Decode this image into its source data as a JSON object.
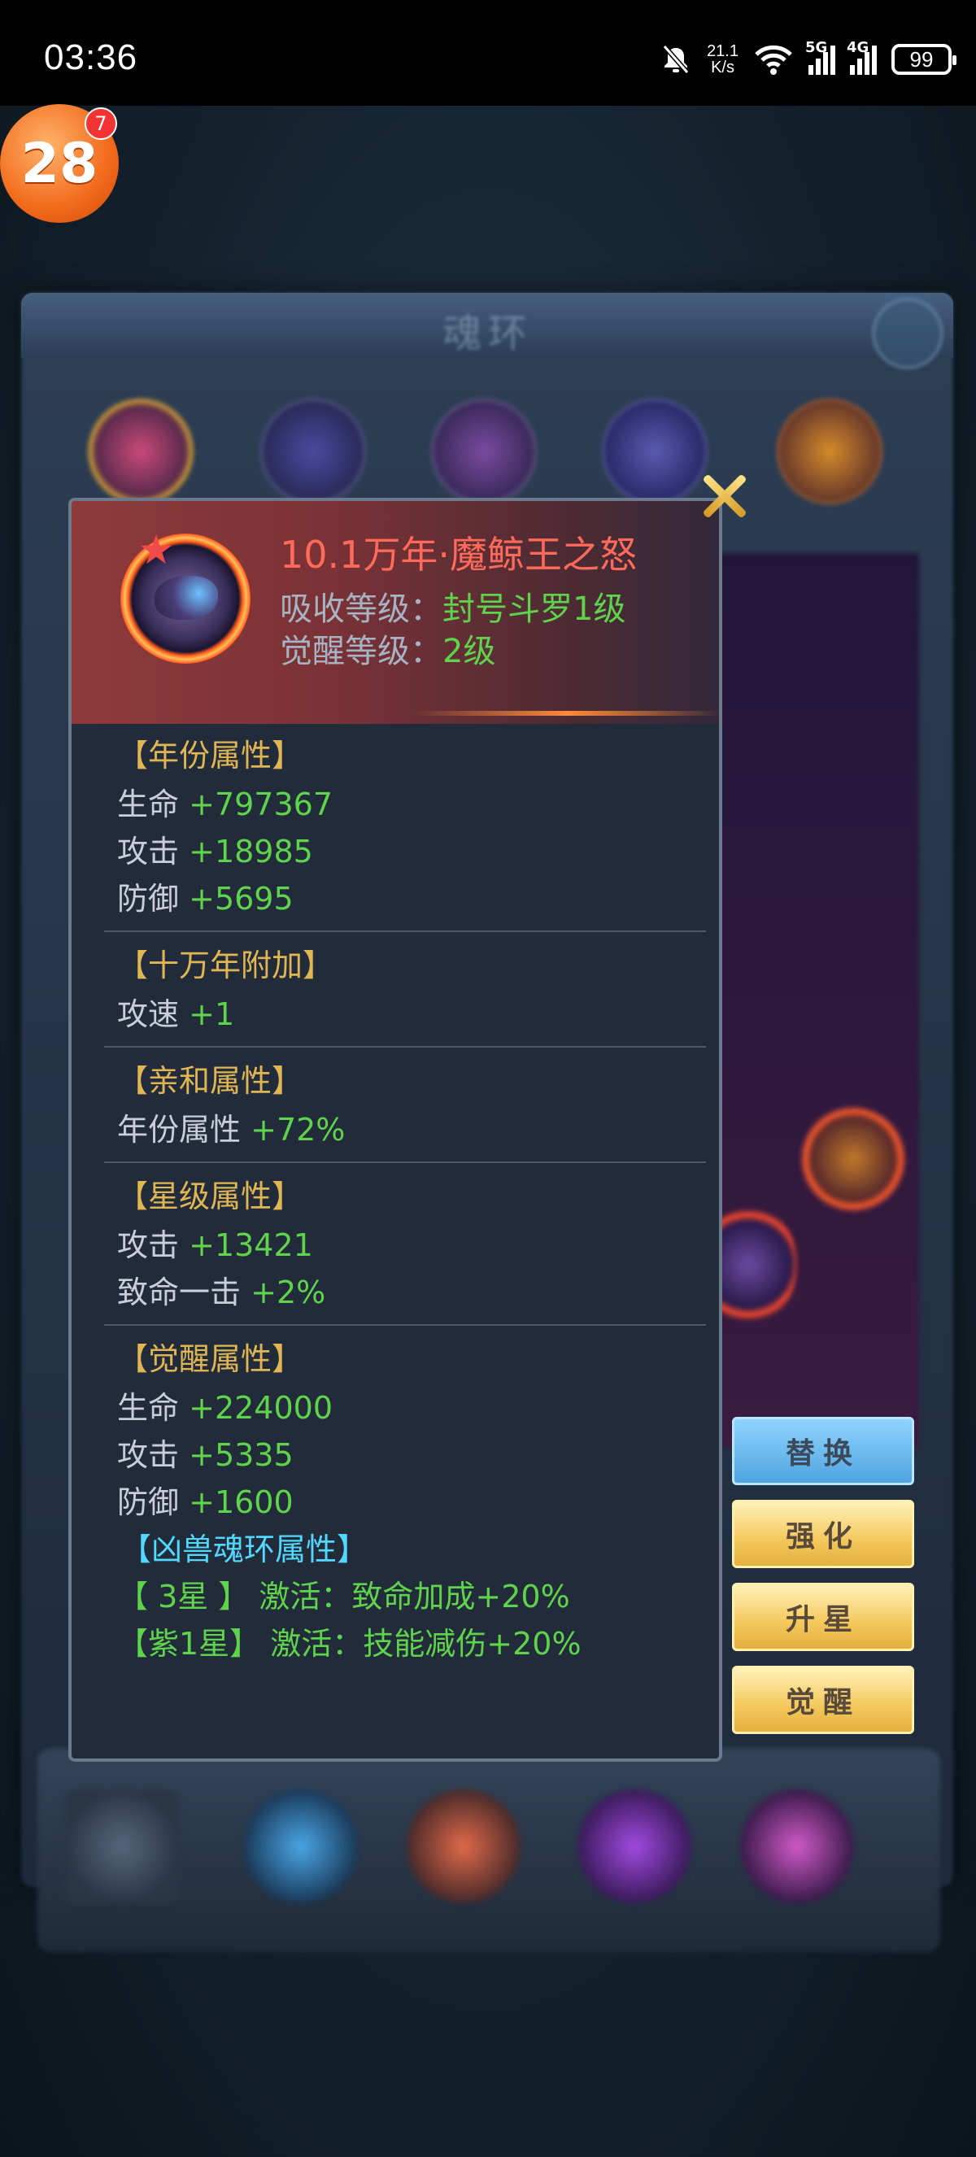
{
  "status_bar": {
    "time": "03:36",
    "net_speed_value": "21.1",
    "net_speed_unit": "K/s",
    "signal_1": "5G",
    "signal_2": "4G",
    "battery": "99"
  },
  "app_badge": {
    "label": "28",
    "count": "7"
  },
  "background": {
    "panel_title": "魂环"
  },
  "ring": {
    "name": "10.1万年·魔鲸王之怒",
    "absorb_label": "吸收等级：",
    "absorb_value": "封号斗罗1级",
    "awaken_label": "觉醒等级：",
    "awaken_value": "2级"
  },
  "sections": {
    "year": {
      "title": "【年份属性】",
      "stats": [
        {
          "label": "生命",
          "value": "+797367"
        },
        {
          "label": "攻击",
          "value": "+18985"
        },
        {
          "label": "防御",
          "value": "+5695"
        }
      ]
    },
    "bonus": {
      "title": "【十万年附加】",
      "stats": [
        {
          "label": "攻速",
          "value": "+1"
        }
      ]
    },
    "affinity": {
      "title": "【亲和属性】",
      "stats": [
        {
          "label": "年份属性",
          "value": "+72%"
        }
      ]
    },
    "star": {
      "title": "【星级属性】",
      "stats": [
        {
          "label": "攻击",
          "value": "+13421"
        },
        {
          "label": "致命一击",
          "value": "+2%"
        }
      ]
    },
    "awaken": {
      "title": "【觉醒属性】",
      "stats": [
        {
          "label": "生命",
          "value": "+224000"
        },
        {
          "label": "攻击",
          "value": "+5335"
        },
        {
          "label": "防御",
          "value": "+1600"
        }
      ]
    },
    "beast": {
      "title": "【凶兽魂环属性】",
      "lines": [
        "【 3星 】 激活：致命加成+20%",
        "【紫1星】 激活：技能减伤+20%"
      ]
    }
  },
  "buttons": {
    "replace": "替换",
    "enhance": "强化",
    "starup": "升星",
    "awaken": "觉醒"
  },
  "colors": {
    "title_gold": "#e0b654",
    "value_green": "#5fd34c",
    "ring_name_red": "#ff6a5a",
    "beast_cyan": "#52d7ff"
  }
}
